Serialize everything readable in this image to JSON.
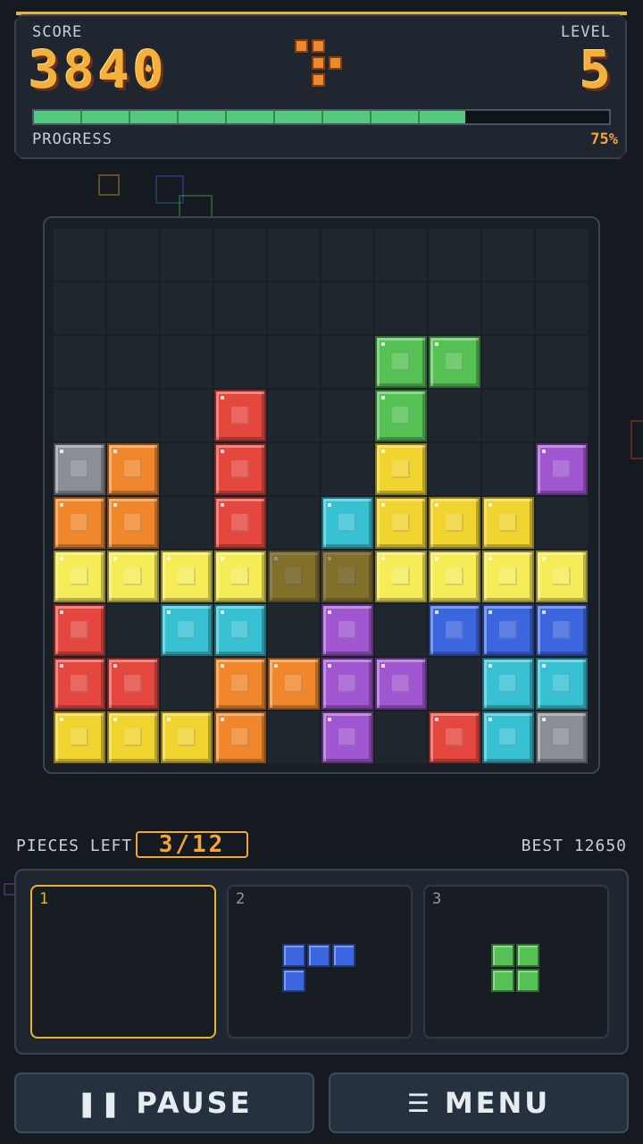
{
  "header": {
    "score_label": "SCORE",
    "score_value": "3840",
    "level_label": "LEVEL",
    "level_value": "5",
    "progress_label": "PROGRESS",
    "progress_percent": 75,
    "progress_text": "75%"
  },
  "colors": {
    "red": "#e5473f",
    "orange": "#f1872d",
    "yellow": "#f2d431",
    "yellow_bright": "#f5ec57",
    "green": "#56c255",
    "cyan": "#37c1d3",
    "blue": "#3c66df",
    "purple": "#a056d0",
    "gray": "#8a8f96",
    "accent": "#e8b531"
  },
  "board": {
    "rows": 10,
    "cols": 10,
    "grid": [
      [
        "",
        "",
        "",
        "",
        "",
        "",
        "",
        "",
        "",
        ""
      ],
      [
        "",
        "",
        "",
        "",
        "",
        "",
        "",
        "",
        "",
        ""
      ],
      [
        "",
        "",
        "",
        "",
        "",
        "",
        "green",
        "green",
        "",
        ""
      ],
      [
        "",
        "",
        "",
        "red",
        "",
        "",
        "green",
        "",
        "",
        ""
      ],
      [
        "gray",
        "orange",
        "",
        "red",
        "",
        "",
        "yellow",
        "",
        "",
        "purple"
      ],
      [
        "orange",
        "orange",
        "",
        "red",
        "",
        "cyan",
        "yellow",
        "yellow",
        "yellow",
        ""
      ],
      [
        "yellow_bright",
        "yellow_bright",
        "yellow_bright",
        "yellow_bright",
        "ghost",
        "ghost",
        "yellow_bright",
        "yellow_bright",
        "yellow_bright",
        "yellow_bright"
      ],
      [
        "red",
        "",
        "cyan",
        "cyan",
        "",
        "purple",
        "",
        "blue",
        "blue",
        "blue"
      ],
      [
        "red",
        "red",
        "",
        "orange",
        "orange",
        "purple",
        "purple",
        "",
        "cyan",
        "cyan"
      ],
      [
        "yellow",
        "yellow",
        "yellow",
        "orange",
        "",
        "purple",
        "",
        "red",
        "cyan",
        "gray"
      ]
    ]
  },
  "footer": {
    "pieces_left_label": "PIECES LEFT",
    "pieces_left_value": "3/12",
    "best_label": "BEST 12650"
  },
  "tray": {
    "slots": [
      {
        "number": "1",
        "selected": true,
        "color": "",
        "cells": []
      },
      {
        "number": "2",
        "selected": false,
        "color": "blue",
        "cells": [
          [
            0,
            0
          ],
          [
            1,
            0
          ],
          [
            2,
            0
          ],
          [
            0,
            1
          ]
        ]
      },
      {
        "number": "3",
        "selected": false,
        "color": "green",
        "cells": [
          [
            0,
            0
          ],
          [
            1,
            0
          ],
          [
            0,
            1
          ],
          [
            1,
            1
          ]
        ]
      }
    ]
  },
  "buttons": {
    "pause_label": "PAUSE",
    "menu_label": "MENU",
    "pause_icon": "pause-icon",
    "menu_icon": "hamburger-menu-icon"
  }
}
